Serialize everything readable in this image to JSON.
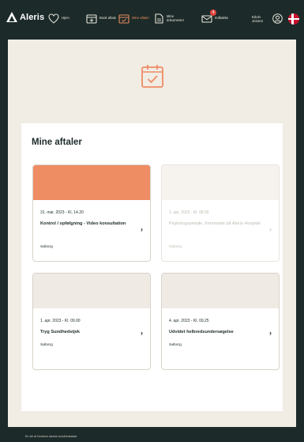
{
  "brand": {
    "name": "Aleris"
  },
  "nav": [
    {
      "id": "hjem",
      "label": "Hjem",
      "icon": "heart-icon"
    },
    {
      "id": "book-aftale",
      "label": "Book aftale",
      "icon": "calendar-plus-icon"
    },
    {
      "id": "mine-aftaler",
      "label": "Mine aftaler",
      "icon": "calendar-check-icon",
      "active": true
    },
    {
      "id": "mine-dokumenter",
      "label": "Mine dokumenter",
      "icon": "document-icon"
    },
    {
      "id": "indbakke",
      "label": "Indbakke",
      "icon": "mail-icon",
      "badge": "4"
    }
  ],
  "user": {
    "name": "Edvin Jensen",
    "icon": "user-circle-icon",
    "language_flag": "danish-flag-icon"
  },
  "main": {
    "hero_icon": "calendar-check-icon",
    "title": "Mine aftaler",
    "appointments": [
      {
        "date": "31. mar. 2023 - Kl. 14.20",
        "title": "Kontrol / opfølgning - Video konsultation",
        "location": "Søborg",
        "band_color": "#ee8c64",
        "faded": false
      },
      {
        "date": "1. apr. 2023 - Kl. 08.00",
        "title": "Psykologsamtale, fremmøde på Aleris Hospital",
        "location": "Søborg",
        "band_color": "#f6f3ef",
        "faded": true
      },
      {
        "date": "1. apr. 2023 - Kl. 09.00",
        "title": "Tryg Sundhedstjek",
        "location": "Søborg",
        "band_color": "#efebe4",
        "faded": false
      },
      {
        "date": "4. apr. 2023 - Kl. 09.25",
        "title": "Udvidet helbredsundersøgelse",
        "location": "Søborg",
        "band_color": "#efebe4",
        "faded": false
      }
    ]
  },
  "footer": {
    "text": "En del af Nordens største sundhedsaktør"
  },
  "colors": {
    "background_dark": "#1c2b2a",
    "accent": "#ee8c64",
    "page": "#f1ece4",
    "badge": "#e0463f"
  }
}
